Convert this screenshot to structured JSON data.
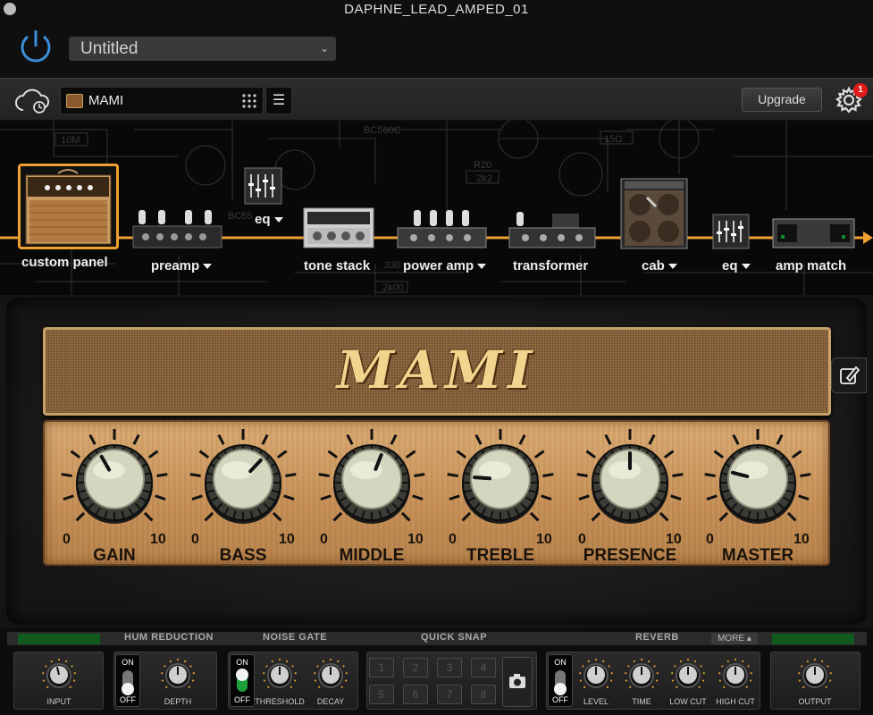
{
  "window": {
    "title": "DAPHNE_LEAD_AMPED_01"
  },
  "header": {
    "preset_name": "Untitled"
  },
  "toolbar": {
    "model_name": "MAMI",
    "upgrade_label": "Upgrade",
    "notification_count": "1"
  },
  "chain": {
    "items": [
      {
        "label": "custom panel",
        "dropdown": false
      },
      {
        "label": "preamp",
        "dropdown": true
      },
      {
        "label": "eq",
        "dropdown": true
      },
      {
        "label": "tone stack",
        "dropdown": false
      },
      {
        "label": "power amp",
        "dropdown": true
      },
      {
        "label": "transformer",
        "dropdown": false
      },
      {
        "label": "cab",
        "dropdown": true
      },
      {
        "label": "eq",
        "dropdown": true
      },
      {
        "label": "amp match",
        "dropdown": false
      }
    ],
    "accent_color": "#f0a030",
    "selected": "custom panel"
  },
  "amp": {
    "logo": "MAMI",
    "scale_min": "0",
    "scale_max": "10",
    "knobs": [
      {
        "name": "GAIN",
        "value": 3.9
      },
      {
        "name": "BASS",
        "value": 6.6
      },
      {
        "name": "MIDDLE",
        "value": 5.8
      },
      {
        "name": "TREBLE",
        "value": 1.8
      },
      {
        "name": "PRESENCE",
        "value": 5.0
      },
      {
        "name": "MASTER",
        "value": 2.2
      }
    ]
  },
  "bottom": {
    "sections": {
      "hum_reduction": "HUM REDUCTION",
      "noise_gate": "NOISE GATE",
      "quick_snap": "QUICK SNAP",
      "reverb": "REVERB",
      "more": "MORE"
    },
    "input_label": "INPUT",
    "depth_label": "DEPTH",
    "threshold_label": "THRESHOLD",
    "decay_label": "DECAY",
    "level_label": "LEVEL",
    "time_label": "TIME",
    "low_cut_label": "LOW CUT",
    "high_cut_label": "HIGH CUT",
    "output_label": "OUTPUT",
    "on_label": "ON",
    "off_label": "OFF",
    "hum_toggle": "off",
    "gate_toggle": "on",
    "reverb_toggle": "off",
    "snaps": [
      "1",
      "2",
      "3",
      "4",
      "5",
      "6",
      "7",
      "8"
    ]
  }
}
